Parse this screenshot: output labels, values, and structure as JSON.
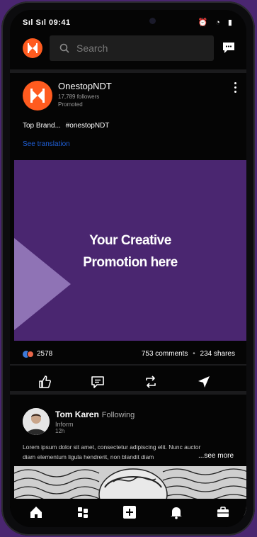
{
  "status_bar": {
    "left_text": "Sıl Sıl 09:41",
    "right_icons": "⏰ ◔ ▮"
  },
  "search": {
    "placeholder": "Search"
  },
  "post1": {
    "author": "OnestopNDT",
    "followers": "17,789 followers",
    "label": "Promoted",
    "text": "Top Brand...",
    "hashtag": "#onestopNDT",
    "translate": "See translation",
    "promo_line1": "Your Creative",
    "promo_line2": "Promotion here",
    "reaction_count": "2578",
    "comments": "753 comments",
    "separator": "•",
    "shares": "234 shares"
  },
  "post2": {
    "author": "Tom Karen",
    "follow_state": "Following",
    "role": "Inform",
    "time": "12h",
    "line1": "Lorem ipsum dolor sit amet, consectetur adipiscing elit. Nunc auctor",
    "line2": "diam elementum ligula hendrerit, non blandit diam",
    "see_more": "...see more"
  },
  "colors": {
    "brand": "#ff5b1f",
    "promo_bg": "#4a2670",
    "link": "#1f5fd6"
  },
  "icons": [
    "search-icon",
    "chat-icon",
    "like-icon",
    "comment-icon",
    "repost-icon",
    "send-icon",
    "home-icon",
    "network-icon",
    "post-icon",
    "notifications-icon",
    "jobs-icon"
  ]
}
